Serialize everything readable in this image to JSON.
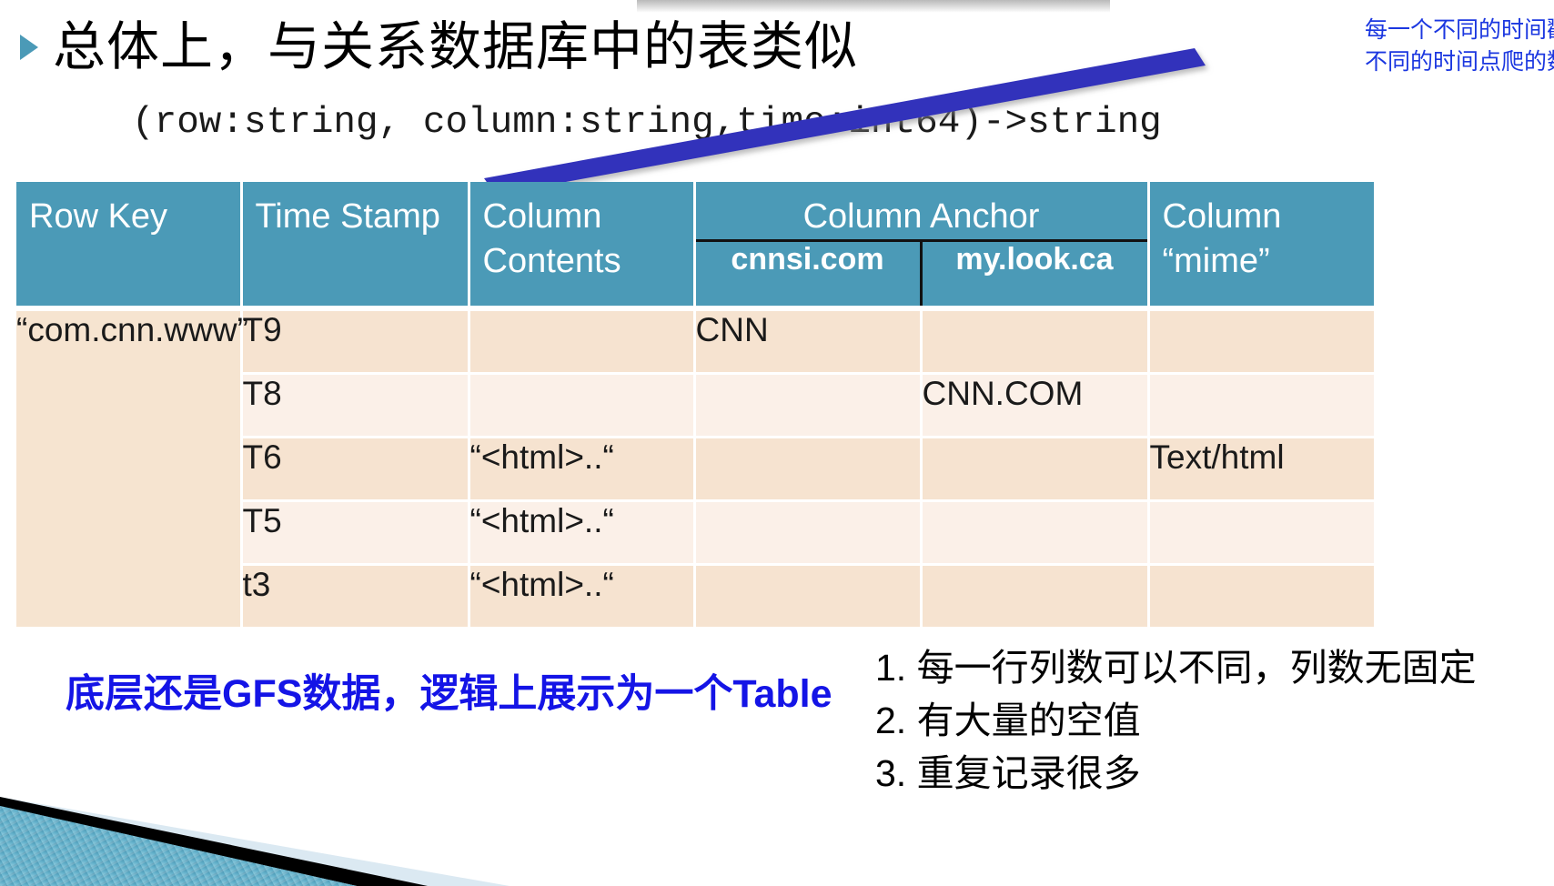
{
  "slide": {
    "title": "总体上，与关系数据库中的表类似",
    "bullet_icon": "triangle-right-icon",
    "code_signature": "(row:string, column:string,time:int64)->string",
    "annotation": {
      "line1": "每一个不同的时间戳表示",
      "line2": "不同的时间点爬的数据",
      "color": "#1b37e0"
    },
    "arrow_color": "#3333bb",
    "accent_color": "#4b9ab7"
  },
  "table": {
    "headers": {
      "row_key": "Row Key",
      "time_stamp": "Time Stamp",
      "column_contents": "Column Contents",
      "column_anchor": "Column Anchor",
      "anchor_sub_1": "cnnsi.com",
      "anchor_sub_2": "my.look.ca",
      "column_mime": "Column “mime”"
    },
    "row_key_value": "“com.cnn.www”",
    "rows": [
      {
        "time": "T9",
        "contents": "",
        "cnnsi": "CNN",
        "mylook": "",
        "mime": ""
      },
      {
        "time": "T8",
        "contents": "",
        "cnnsi": "",
        "mylook": "CNN.COM",
        "mime": ""
      },
      {
        "time": "T6",
        "contents": "“<html>..“",
        "cnnsi": "",
        "mylook": "",
        "mime": "Text/html"
      },
      {
        "time": "T5",
        "contents": "“<html>..“",
        "cnnsi": "",
        "mylook": "",
        "mime": ""
      },
      {
        "time": "t3",
        "contents": "“<html>..“",
        "cnnsi": "",
        "mylook": "",
        "mime": ""
      }
    ],
    "header_bg": "#4b9ab7",
    "band_a": "#f6e3d0",
    "band_b": "#fbf0e8"
  },
  "notes": {
    "gfs_note": "底层还是GFS数据，逻辑上展示为一个Table",
    "gfs_note_color": "#1414e6",
    "list": [
      "1. 每一行列数可以不同，列数无固定",
      "2. 有大量的空值",
      "3. 重复记录很多"
    ]
  }
}
